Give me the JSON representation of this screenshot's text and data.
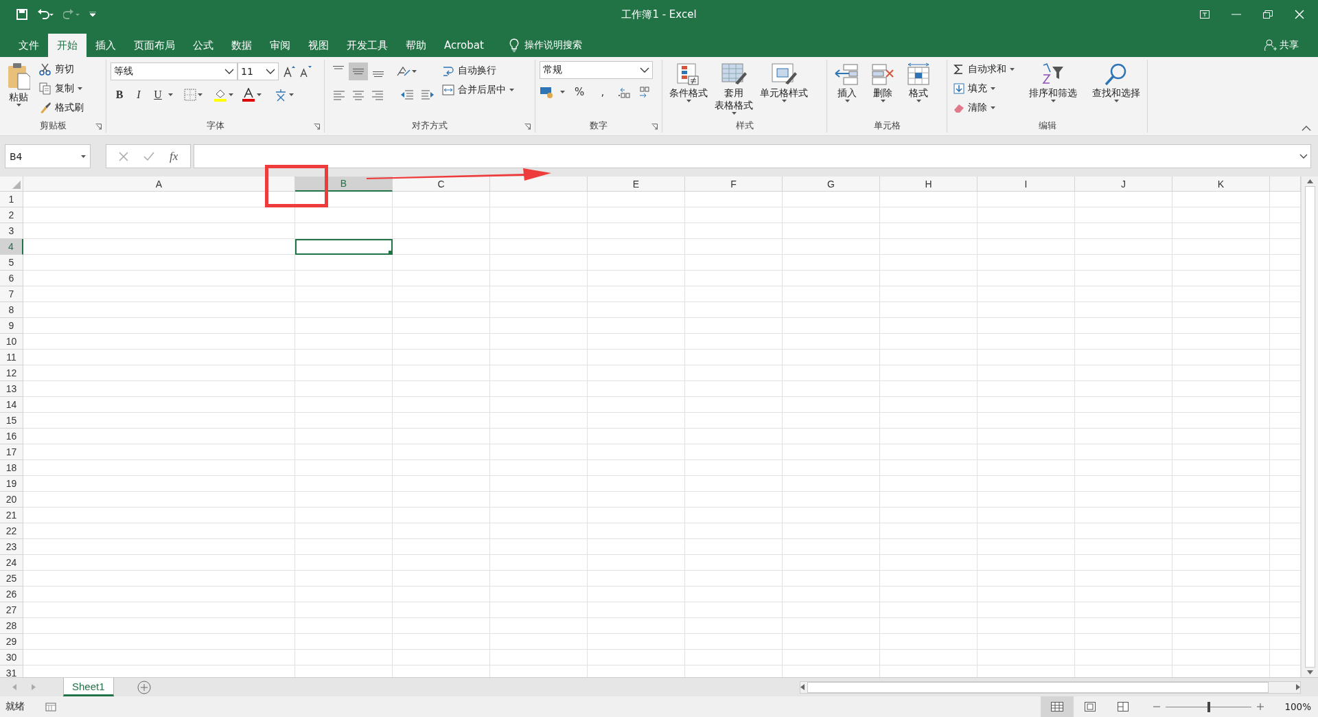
{
  "title_bar": {
    "title": "工作簿1 - Excel"
  },
  "tabs": [
    {
      "label": "文件",
      "selected": false
    },
    {
      "label": "开始",
      "selected": true
    },
    {
      "label": "插入",
      "selected": false
    },
    {
      "label": "页面布局",
      "selected": false
    },
    {
      "label": "公式",
      "selected": false
    },
    {
      "label": "数据",
      "selected": false
    },
    {
      "label": "审阅",
      "selected": false
    },
    {
      "label": "视图",
      "selected": false
    },
    {
      "label": "开发工具",
      "selected": false
    },
    {
      "label": "帮助",
      "selected": false
    },
    {
      "label": "Acrobat",
      "selected": false
    }
  ],
  "tell_me": {
    "label": "操作说明搜索"
  },
  "share": {
    "label": "共享"
  },
  "ribbon": {
    "clipboard": {
      "paste": "粘贴",
      "items": [
        "剪切",
        "复制",
        "格式刷"
      ],
      "label": "剪贴板"
    },
    "font": {
      "font_name": "等线",
      "font_size": "11",
      "styles": [
        "B",
        "I",
        "U"
      ],
      "label": "字体"
    },
    "alignment": {
      "vertical": [
        {
          "selected": false
        },
        {
          "selected": true
        },
        {
          "selected": false
        }
      ],
      "wrap": "自动换行",
      "merge": "合并后居中",
      "label": "对齐方式"
    },
    "number": {
      "format": "常规",
      "symbols": [
        "%",
        ","
      ],
      "label": "数字"
    },
    "styles": {
      "buttons": [
        {
          "label": "条件格式"
        },
        {
          "label": "套用",
          "label_2": "表格格式"
        },
        {
          "label": "单元格样式"
        }
      ],
      "label": "样式"
    },
    "cells": {
      "buttons": [
        "插入",
        "删除",
        "格式"
      ],
      "label": "单元格"
    },
    "editing": {
      "items": [
        "自动求和",
        "填充",
        "清除"
      ],
      "buttons": [
        "排序和筛选",
        "查找和选择"
      ],
      "label": "编辑"
    }
  },
  "formula_bar": {
    "name_box": "B4",
    "fx": "fx"
  },
  "grid": {
    "columns": [
      {
        "label": "A",
        "selected": false
      },
      {
        "label": "B",
        "selected": true
      },
      {
        "label": "C",
        "selected": false
      },
      {
        "selected": false
      },
      {
        "label": "E",
        "selected": false
      },
      {
        "label": "F",
        "selected": false
      },
      {
        "label": "G",
        "selected": false
      },
      {
        "label": "H",
        "selected": false
      },
      {
        "label": "I",
        "selected": false
      },
      {
        "label": "J",
        "selected": false
      },
      {
        "label": "K",
        "selected": false
      }
    ],
    "rows": [
      {
        "label": "1",
        "selected": false
      },
      {
        "label": "2",
        "selected": false
      },
      {
        "label": "3",
        "selected": false
      },
      {
        "label": "4",
        "selected": true
      },
      {
        "label": "5",
        "selected": false
      },
      {
        "label": "6",
        "selected": false
      },
      {
        "label": "7",
        "selected": false
      },
      {
        "label": "8",
        "selected": false
      },
      {
        "label": "9",
        "selected": false
      },
      {
        "label": "10",
        "selected": false
      },
      {
        "label": "11",
        "selected": false
      },
      {
        "label": "12",
        "selected": false
      },
      {
        "label": "13",
        "selected": false
      },
      {
        "label": "14",
        "selected": false
      },
      {
        "label": "15",
        "selected": false
      },
      {
        "label": "16",
        "selected": false
      },
      {
        "label": "17",
        "selected": false
      },
      {
        "label": "18",
        "selected": false
      },
      {
        "label": "19",
        "selected": false
      },
      {
        "label": "20",
        "selected": false
      },
      {
        "label": "21",
        "selected": false
      },
      {
        "label": "22",
        "selected": false
      },
      {
        "label": "23",
        "selected": false
      },
      {
        "label": "24",
        "selected": false
      },
      {
        "label": "25",
        "selected": false
      },
      {
        "label": "26",
        "selected": false
      },
      {
        "label": "27",
        "selected": false
      },
      {
        "label": "28",
        "selected": false
      },
      {
        "label": "29",
        "selected": false
      },
      {
        "label": "30",
        "selected": false
      },
      {
        "label": "31",
        "selected": false
      }
    ]
  },
  "annotations": [
    {
      "kind": "rectangle"
    },
    {
      "kind": "arrow"
    }
  ],
  "sheet_tabs": [
    {
      "label": "Sheet1",
      "selected": true
    }
  ],
  "status_bar": {
    "status": "就绪",
    "zoom": {
      "level": 0.5,
      "reading": "100%"
    }
  }
}
